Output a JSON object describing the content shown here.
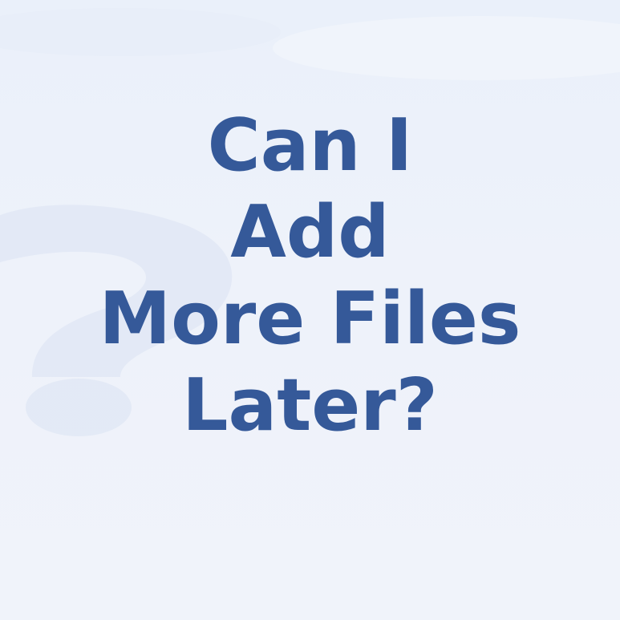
{
  "headline": {
    "lines": [
      "Can I",
      "Add",
      "More Files",
      "Later?"
    ]
  },
  "background": {
    "decor_icon": "question-mark-icon",
    "base_color": "#eef2fa",
    "decor_color": "#e1e7f5"
  },
  "colors": {
    "text": "#355999"
  }
}
